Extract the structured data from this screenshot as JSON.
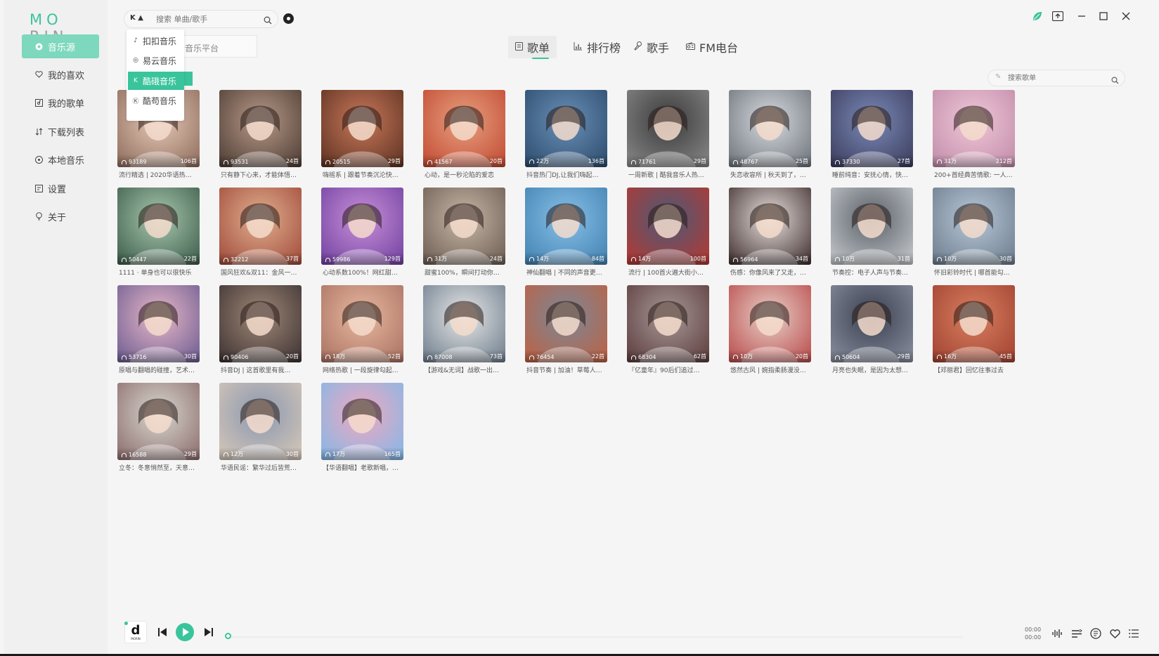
{
  "app": {
    "logo_left": "MO",
    "logo_right": "RIN"
  },
  "sidebar": {
    "items": [
      {
        "label": "音乐源",
        "icon": "music-source-icon"
      },
      {
        "label": "我的喜欢",
        "icon": "heart-icon"
      },
      {
        "label": "我的歌单",
        "icon": "playlist-icon"
      },
      {
        "label": "下载列表",
        "icon": "download-icon"
      },
      {
        "label": "本地音乐",
        "icon": "local-music-icon"
      },
      {
        "label": "设置",
        "icon": "settings-icon"
      },
      {
        "label": "关于",
        "icon": "bulb-icon"
      }
    ]
  },
  "search": {
    "platform_label": "K",
    "placeholder": "搜索 单曲/歌手",
    "platform_hint": "搜索的音乐平台"
  },
  "platform_menu": {
    "items": [
      "扣扣音乐",
      "易云音乐",
      "酷硪音乐",
      "酷苟音乐"
    ]
  },
  "tabs": [
    {
      "label": "歌单",
      "icon": "playlist-tab-icon"
    },
    {
      "label": "排行榜",
      "icon": "chart-icon"
    },
    {
      "label": "歌手",
      "icon": "singer-icon"
    },
    {
      "label": "FM电台",
      "icon": "radio-icon"
    }
  ],
  "playlist_filter": {
    "placeholder": "搜索歌单"
  },
  "playlists": [
    {
      "plays": "93189",
      "count": "106首",
      "title": "流行精选 | 2020华语热…"
    },
    {
      "plays": "93531",
      "count": "24首",
      "title": "只有静下心来，才能体悟…"
    },
    {
      "plays": "20515",
      "count": "29首",
      "title": "嗨摇系 | 跟着节奏沉沦快…"
    },
    {
      "plays": "41567",
      "count": "20首",
      "title": "心动，是一秒沦陷的爱恋"
    },
    {
      "plays": "22万",
      "count": "136首",
      "title": "抖音热门DJ,让我们嗨起…"
    },
    {
      "plays": "71761",
      "count": "29首",
      "title": "一周新歌 | 酷我音乐人热…"
    },
    {
      "plays": "48767",
      "count": "25首",
      "title": "失恋收容所 | 秋天到了，…"
    },
    {
      "plays": "37330",
      "count": "27首",
      "title": "睡前纯音：安抚心情，快…"
    },
    {
      "plays": "31万",
      "count": "212首",
      "title": "200+首经典苦情歌: 一人…"
    },
    {
      "plays": "50447",
      "count": "22首",
      "title": "1111 · 单身也可以很快乐"
    },
    {
      "plays": "32212",
      "count": "37首",
      "title": "国风狂欢&双11：金风一…"
    },
    {
      "plays": "59986",
      "count": "129首",
      "title": "心动系数100%！网红甜…"
    },
    {
      "plays": "31万",
      "count": "24首",
      "title": "甜蜜100%，瞬间打动你…"
    },
    {
      "plays": "14万",
      "count": "84首",
      "title": "神仙翻唱 | 不同的声音更…"
    },
    {
      "plays": "14万",
      "count": "100首",
      "title": "流行 | 100首火遍大街小…"
    },
    {
      "plays": "56964",
      "count": "34首",
      "title": "伤感：你像风来了又走，…"
    },
    {
      "plays": "10万",
      "count": "31首",
      "title": "节奏控：电子人声与节奏…"
    },
    {
      "plays": "10万",
      "count": "30首",
      "title": "怀旧彩铃时代 | 哪首能勾…"
    },
    {
      "plays": "53716",
      "count": "30首",
      "title": "原唱与翻唱的碰撞，艺术…"
    },
    {
      "plays": "90406",
      "count": "20首",
      "title": "抖音DJ | 这首歌里有我…"
    },
    {
      "plays": "18万",
      "count": "52首",
      "title": "网络热歌 | 一段旋律勾起…"
    },
    {
      "plays": "87008",
      "count": "73首",
      "title": "【游戏&无词】战歌一出…"
    },
    {
      "plays": "76454",
      "count": "22首",
      "title": "抖音节奏 | 加油！草莓人…"
    },
    {
      "plays": "68304",
      "count": "62首",
      "title": "『亿童年』90后们追过…"
    },
    {
      "plays": "10万",
      "count": "20首",
      "title": "悠然古风 | 婉指柔肠漫没…"
    },
    {
      "plays": "50604",
      "count": "29首",
      "title": "月亮也失眠，是因为太想…"
    },
    {
      "plays": "16万",
      "count": "45首",
      "title": "【邓丽君】回忆往事过去"
    },
    {
      "plays": "16588",
      "count": "29首",
      "title": "立冬：冬意悄然至，天意…"
    },
    {
      "plays": "12万",
      "count": "30首",
      "title": "华语民谣：繁华过后皆荒…"
    },
    {
      "plays": "17万",
      "count": "165首",
      "title": "【华语翻唱】老歌新唱，…"
    }
  ],
  "player": {
    "logo_letter": "d",
    "logo_sub": "MORIN",
    "time_current": "00:00",
    "time_total": "00:00"
  },
  "colors": {
    "accent": "#3ac49c",
    "sidebar_active": "#7dd8bd"
  }
}
